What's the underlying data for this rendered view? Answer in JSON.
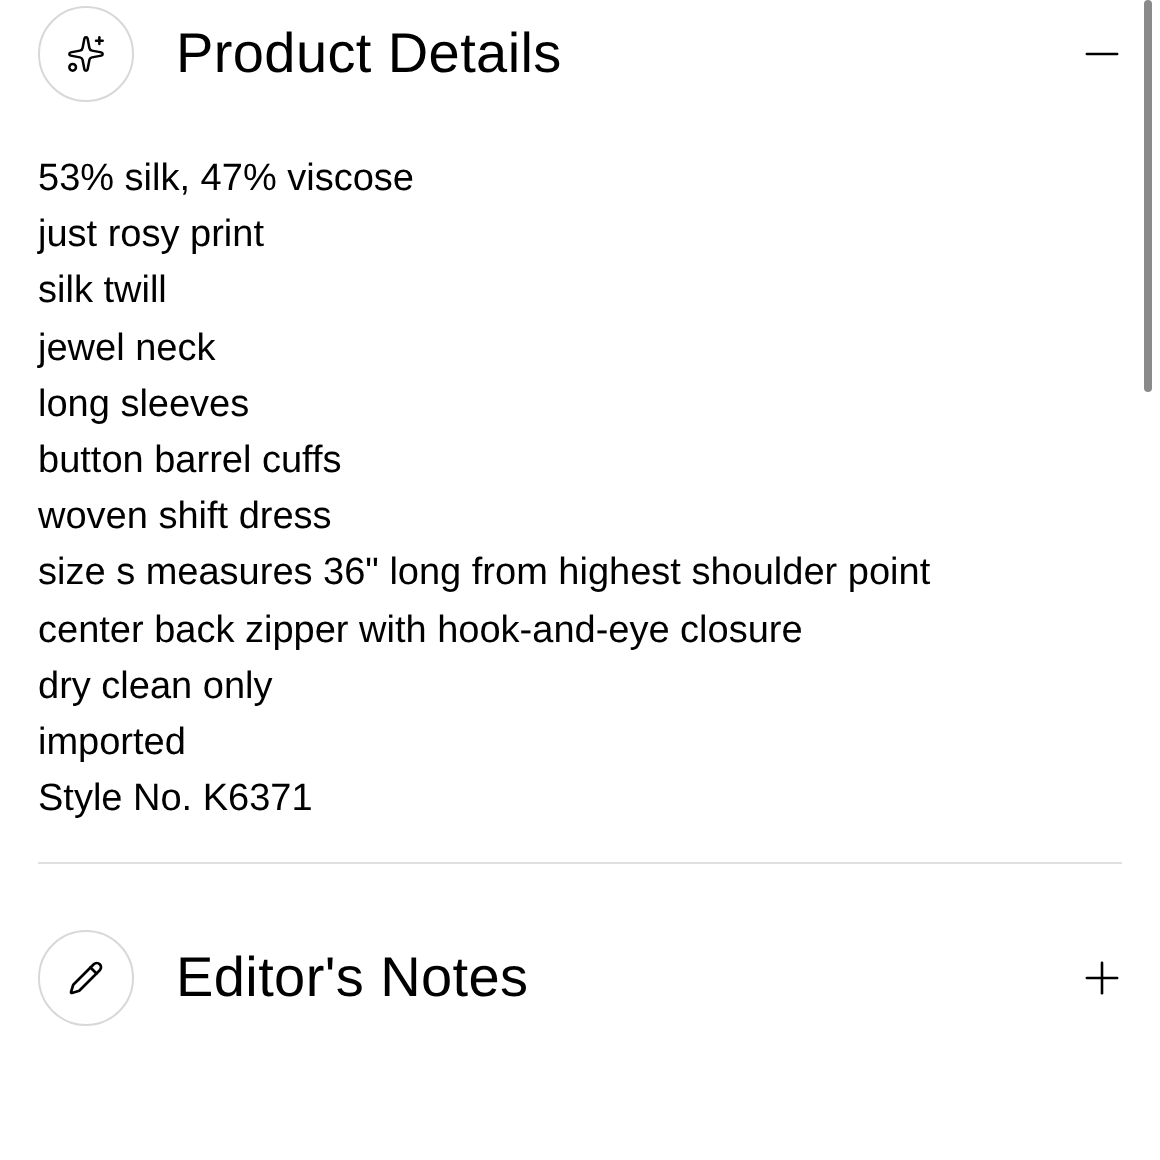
{
  "sections": [
    {
      "kind": "sparkles",
      "title": "Product Details",
      "expanded": true,
      "lines": [
        "53% silk, 47% viscose",
        "just rosy print",
        "silk twill",
        "jewel neck",
        "long sleeves",
        "button barrel cuffs",
        "woven shift dress",
        "size s measures 36\" long from highest shoulder point",
        "center back zipper with hook-and-eye closure",
        "dry clean only",
        "imported",
        "Style No. K6371"
      ]
    },
    {
      "kind": "pencil",
      "title": "Editor's Notes",
      "expanded": false
    }
  ]
}
